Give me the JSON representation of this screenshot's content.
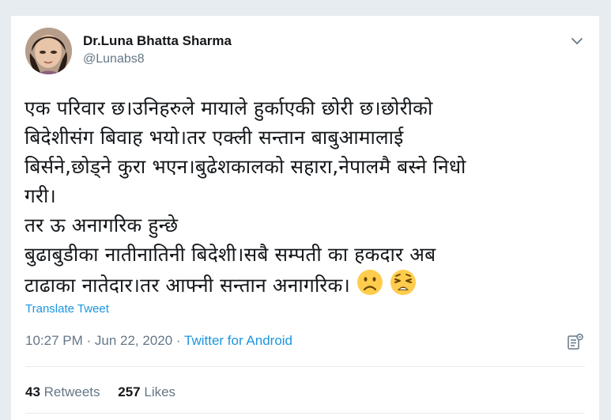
{
  "author": {
    "name": "Dr.Luna Bhatta Sharma",
    "handle": "@Lunabs8"
  },
  "tweet": {
    "lines": [
      "एक परिवार छ।उनिहरुले मायाले हुर्काएकी छोरी छ।छोरीको",
      "बिदेशीसंग बिवाह भयो।तर एक्ली सन्तान बाबुआमालाई",
      "बिर्सने,छोड्ने कुरा भएन।बुढेशकालको सहारा,नेपालमै बस्ने निधो",
      "गरी।",
      "तर ऊ अनागरिक हुन्छे",
      "बुढाबुडीका नातीनातिनी बिदेशी।सबै सम्पती का हकदार अब",
      "टाढाका नातेदार।तर आफ्नी सन्तान अनागरिक।"
    ],
    "emojis": [
      "frowning-face",
      "weary-face"
    ]
  },
  "translate_label": "Translate Tweet",
  "meta": {
    "time": "10:27 PM",
    "separator1": " · ",
    "date": "Jun 22, 2020",
    "separator2": " · ",
    "source": "Twitter for Android"
  },
  "stats": {
    "retweets_count": "43",
    "retweets_label": "Retweets",
    "likes_count": "257",
    "likes_label": "Likes"
  },
  "icons": {
    "caret": "chevron-down-icon",
    "analytics": "analytics-icon"
  },
  "colors": {
    "link": "#1b95e0",
    "secondary_text": "#657786",
    "primary_text": "#14171a",
    "emoji_face": "#ffcc4d"
  }
}
